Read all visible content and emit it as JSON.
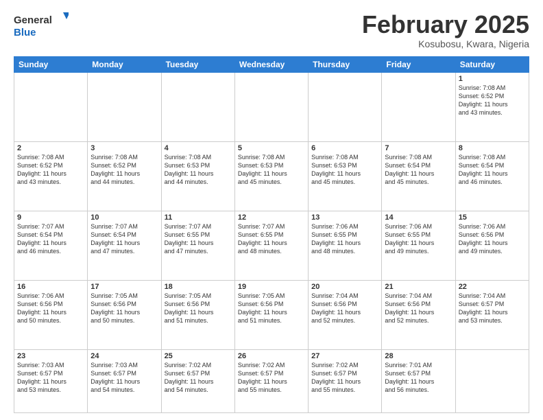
{
  "logo": {
    "general": "General",
    "blue": "Blue"
  },
  "calendar": {
    "title": "February 2025",
    "subtitle": "Kosubosu, Kwara, Nigeria",
    "days_of_week": [
      "Sunday",
      "Monday",
      "Tuesday",
      "Wednesday",
      "Thursday",
      "Friday",
      "Saturday"
    ],
    "weeks": [
      [
        {
          "day": "",
          "info": ""
        },
        {
          "day": "",
          "info": ""
        },
        {
          "day": "",
          "info": ""
        },
        {
          "day": "",
          "info": ""
        },
        {
          "day": "",
          "info": ""
        },
        {
          "day": "",
          "info": ""
        },
        {
          "day": "1",
          "info": "Sunrise: 7:08 AM\nSunset: 6:52 PM\nDaylight: 11 hours\nand 43 minutes."
        }
      ],
      [
        {
          "day": "2",
          "info": "Sunrise: 7:08 AM\nSunset: 6:52 PM\nDaylight: 11 hours\nand 43 minutes."
        },
        {
          "day": "3",
          "info": "Sunrise: 7:08 AM\nSunset: 6:52 PM\nDaylight: 11 hours\nand 44 minutes."
        },
        {
          "day": "4",
          "info": "Sunrise: 7:08 AM\nSunset: 6:53 PM\nDaylight: 11 hours\nand 44 minutes."
        },
        {
          "day": "5",
          "info": "Sunrise: 7:08 AM\nSunset: 6:53 PM\nDaylight: 11 hours\nand 45 minutes."
        },
        {
          "day": "6",
          "info": "Sunrise: 7:08 AM\nSunset: 6:53 PM\nDaylight: 11 hours\nand 45 minutes."
        },
        {
          "day": "7",
          "info": "Sunrise: 7:08 AM\nSunset: 6:54 PM\nDaylight: 11 hours\nand 45 minutes."
        },
        {
          "day": "8",
          "info": "Sunrise: 7:08 AM\nSunset: 6:54 PM\nDaylight: 11 hours\nand 46 minutes."
        }
      ],
      [
        {
          "day": "9",
          "info": "Sunrise: 7:07 AM\nSunset: 6:54 PM\nDaylight: 11 hours\nand 46 minutes."
        },
        {
          "day": "10",
          "info": "Sunrise: 7:07 AM\nSunset: 6:54 PM\nDaylight: 11 hours\nand 47 minutes."
        },
        {
          "day": "11",
          "info": "Sunrise: 7:07 AM\nSunset: 6:55 PM\nDaylight: 11 hours\nand 47 minutes."
        },
        {
          "day": "12",
          "info": "Sunrise: 7:07 AM\nSunset: 6:55 PM\nDaylight: 11 hours\nand 48 minutes."
        },
        {
          "day": "13",
          "info": "Sunrise: 7:06 AM\nSunset: 6:55 PM\nDaylight: 11 hours\nand 48 minutes."
        },
        {
          "day": "14",
          "info": "Sunrise: 7:06 AM\nSunset: 6:55 PM\nDaylight: 11 hours\nand 49 minutes."
        },
        {
          "day": "15",
          "info": "Sunrise: 7:06 AM\nSunset: 6:56 PM\nDaylight: 11 hours\nand 49 minutes."
        }
      ],
      [
        {
          "day": "16",
          "info": "Sunrise: 7:06 AM\nSunset: 6:56 PM\nDaylight: 11 hours\nand 50 minutes."
        },
        {
          "day": "17",
          "info": "Sunrise: 7:05 AM\nSunset: 6:56 PM\nDaylight: 11 hours\nand 50 minutes."
        },
        {
          "day": "18",
          "info": "Sunrise: 7:05 AM\nSunset: 6:56 PM\nDaylight: 11 hours\nand 51 minutes."
        },
        {
          "day": "19",
          "info": "Sunrise: 7:05 AM\nSunset: 6:56 PM\nDaylight: 11 hours\nand 51 minutes."
        },
        {
          "day": "20",
          "info": "Sunrise: 7:04 AM\nSunset: 6:56 PM\nDaylight: 11 hours\nand 52 minutes."
        },
        {
          "day": "21",
          "info": "Sunrise: 7:04 AM\nSunset: 6:56 PM\nDaylight: 11 hours\nand 52 minutes."
        },
        {
          "day": "22",
          "info": "Sunrise: 7:04 AM\nSunset: 6:57 PM\nDaylight: 11 hours\nand 53 minutes."
        }
      ],
      [
        {
          "day": "23",
          "info": "Sunrise: 7:03 AM\nSunset: 6:57 PM\nDaylight: 11 hours\nand 53 minutes."
        },
        {
          "day": "24",
          "info": "Sunrise: 7:03 AM\nSunset: 6:57 PM\nDaylight: 11 hours\nand 54 minutes."
        },
        {
          "day": "25",
          "info": "Sunrise: 7:02 AM\nSunset: 6:57 PM\nDaylight: 11 hours\nand 54 minutes."
        },
        {
          "day": "26",
          "info": "Sunrise: 7:02 AM\nSunset: 6:57 PM\nDaylight: 11 hours\nand 55 minutes."
        },
        {
          "day": "27",
          "info": "Sunrise: 7:02 AM\nSunset: 6:57 PM\nDaylight: 11 hours\nand 55 minutes."
        },
        {
          "day": "28",
          "info": "Sunrise: 7:01 AM\nSunset: 6:57 PM\nDaylight: 11 hours\nand 56 minutes."
        },
        {
          "day": "",
          "info": ""
        }
      ]
    ]
  }
}
